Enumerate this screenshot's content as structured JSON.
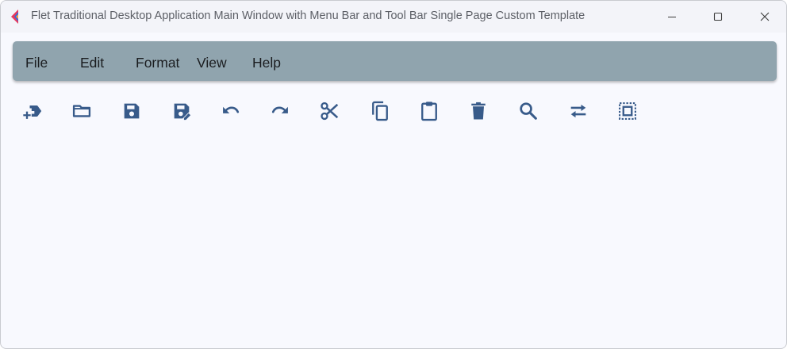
{
  "window": {
    "title": "Flet Traditional Desktop Application Main Window with Menu Bar and Tool Bar Single Page Custom Template",
    "controls": [
      "minimize-icon",
      "maximize-icon",
      "close-icon"
    ]
  },
  "menu": {
    "items": [
      {
        "label": "File"
      },
      {
        "label": "Edit"
      },
      {
        "label": "Format"
      },
      {
        "label": "View"
      },
      {
        "label": "Help"
      }
    ]
  },
  "toolbar": {
    "icon_color": "#385b8a",
    "tools": [
      {
        "icon": "new-label-icon"
      },
      {
        "icon": "folder-open-icon"
      },
      {
        "icon": "save-icon"
      },
      {
        "icon": "save-as-icon"
      },
      {
        "icon": "undo-icon"
      },
      {
        "icon": "redo-icon"
      },
      {
        "icon": "cut-icon"
      },
      {
        "icon": "copy-icon"
      },
      {
        "icon": "paste-icon"
      },
      {
        "icon": "delete-icon"
      },
      {
        "icon": "search-icon"
      },
      {
        "icon": "swap-icon"
      },
      {
        "icon": "select-all-icon"
      }
    ]
  },
  "colors": {
    "menubar": "#90a4ae",
    "background": "#f8f9fe",
    "titlebar": "#f3f4f9"
  }
}
